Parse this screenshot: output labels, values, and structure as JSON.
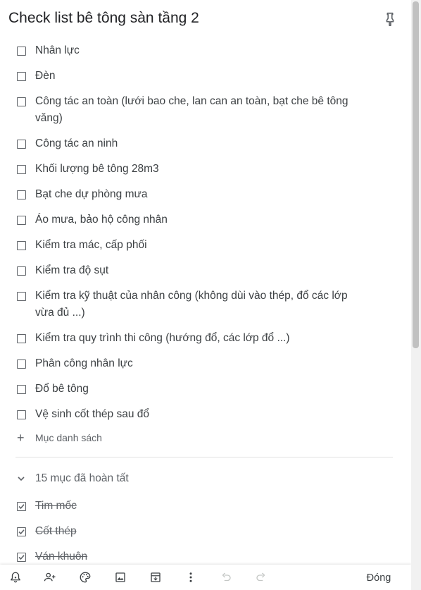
{
  "note": {
    "title": "Check list bê tông sàn tầng 2"
  },
  "checklist": {
    "items": [
      "Nhân lực",
      "Đèn",
      "Công tác an toàn (lưới bao che, lan can an toàn, bạt che bê tông văng)",
      "Công tác an ninh",
      "Khối lượng bê tông 28m3",
      "Bạt che dự phòng mưa",
      "Áo mưa, bảo hộ công nhân",
      "Kiểm tra mác, cấp phối",
      "Kiểm tra độ sụt",
      "Kiểm tra kỹ thuật của nhân công (không dùi vào thép, đổ các lớp vừa đủ ...)",
      "Kiểm tra quy trình thi công (hướng đổ, các lớp đổ ...)",
      "Phân công nhân lực",
      "Đổ bê tông",
      "Vệ sinh cốt thép sau đổ"
    ],
    "add_item_label": "Mục danh sách",
    "completed_header": "15 mục đã hoàn tất",
    "completed_items": [
      "Tim mốc",
      "Cốt thép",
      "Ván khuôn"
    ]
  },
  "toolbar": {
    "icons": [
      "remind-me-icon",
      "collaborator-icon",
      "background-options-icon",
      "add-image-icon",
      "archive-icon",
      "more-icon",
      "undo-icon",
      "redo-icon"
    ],
    "close_label": "Đóng"
  }
}
